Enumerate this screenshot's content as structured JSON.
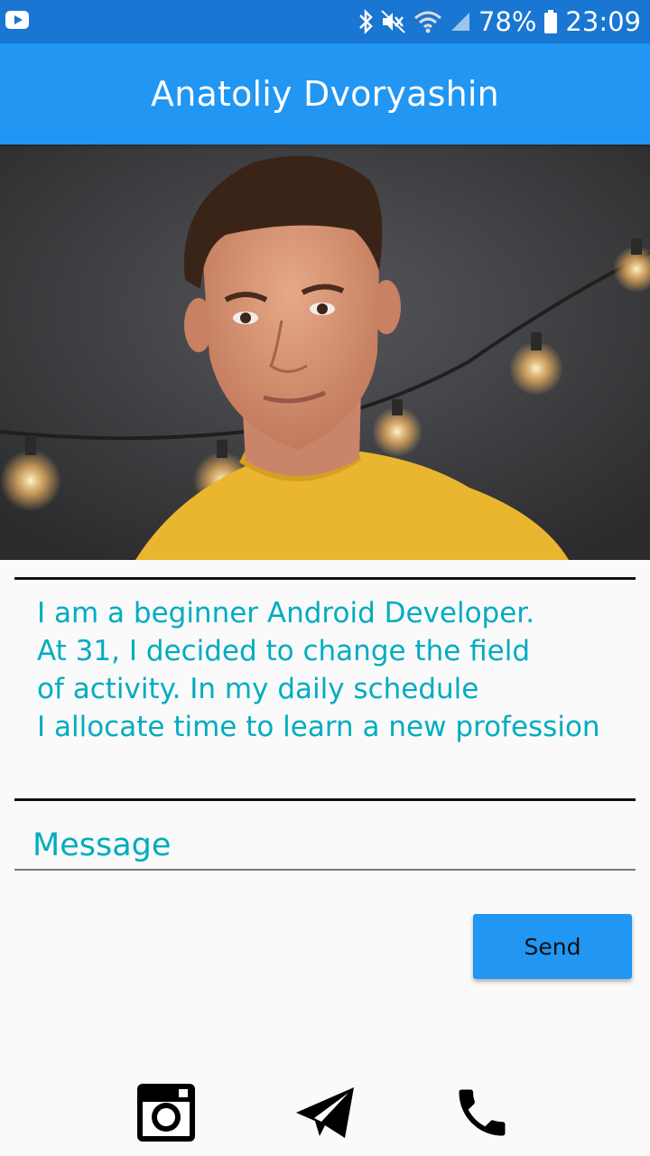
{
  "status_bar": {
    "battery": "78%",
    "time": "23:09",
    "icons": [
      "youtube-notification-icon",
      "bluetooth-icon",
      "mute-icon",
      "wifi-icon",
      "signal-icon",
      "battery-icon"
    ]
  },
  "app_bar": {
    "title": "Anatoliy Dvoryashin"
  },
  "profile": {
    "photo": "portrait-photo",
    "bio_lines": [
      "I am a beginner Android Developer.",
      "At 31, I decided to change the field",
      "of activity. In my daily schedule",
      "I allocate time to learn a new profession"
    ]
  },
  "message": {
    "placeholder": "Message",
    "value": ""
  },
  "send_button": {
    "label": "Send"
  },
  "bottom_icons": [
    "instagram-icon",
    "telegram-icon",
    "phone-icon"
  ],
  "colors": {
    "status_bar": "#1976d2",
    "app_bar": "#2196f3",
    "accent_text": "#00acc1",
    "button": "#2196f3"
  }
}
